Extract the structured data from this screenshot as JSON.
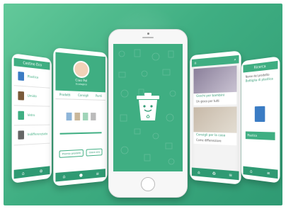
{
  "left_phone": {
    "header_title": "Cestino Eco",
    "rows": [
      {
        "label": "Plastica",
        "color": "#3b7cc4"
      },
      {
        "label": "Umido",
        "color": "#7a5a3a"
      },
      {
        "label": "Vetro",
        "color": "#3fae82"
      },
      {
        "label": "Indifferenziato",
        "color": "#666666"
      }
    ]
  },
  "profile_phone": {
    "user_name": "Ciao Pol",
    "sub": "Ecologico",
    "tabs": [
      "Prodotti",
      "Consigli",
      "Punti"
    ],
    "button_left": "Premio prodotti",
    "button_right": "Gioca ora"
  },
  "center_phone": {
    "icon": "smiling-trash-can-icon",
    "accent": "#3fae82"
  },
  "feed_phone": {
    "cards": [
      {
        "title": "Giochi per bambini",
        "sub": "Un gioco per tutti"
      },
      {
        "title": "Consigli per la casa",
        "sub": "Come differenziare"
      }
    ]
  },
  "right_phone": {
    "header_title": "Ricerca",
    "product_label": "Nome del prodotto",
    "product_name": "Bottiglia di plastica",
    "result": "Plastica"
  }
}
